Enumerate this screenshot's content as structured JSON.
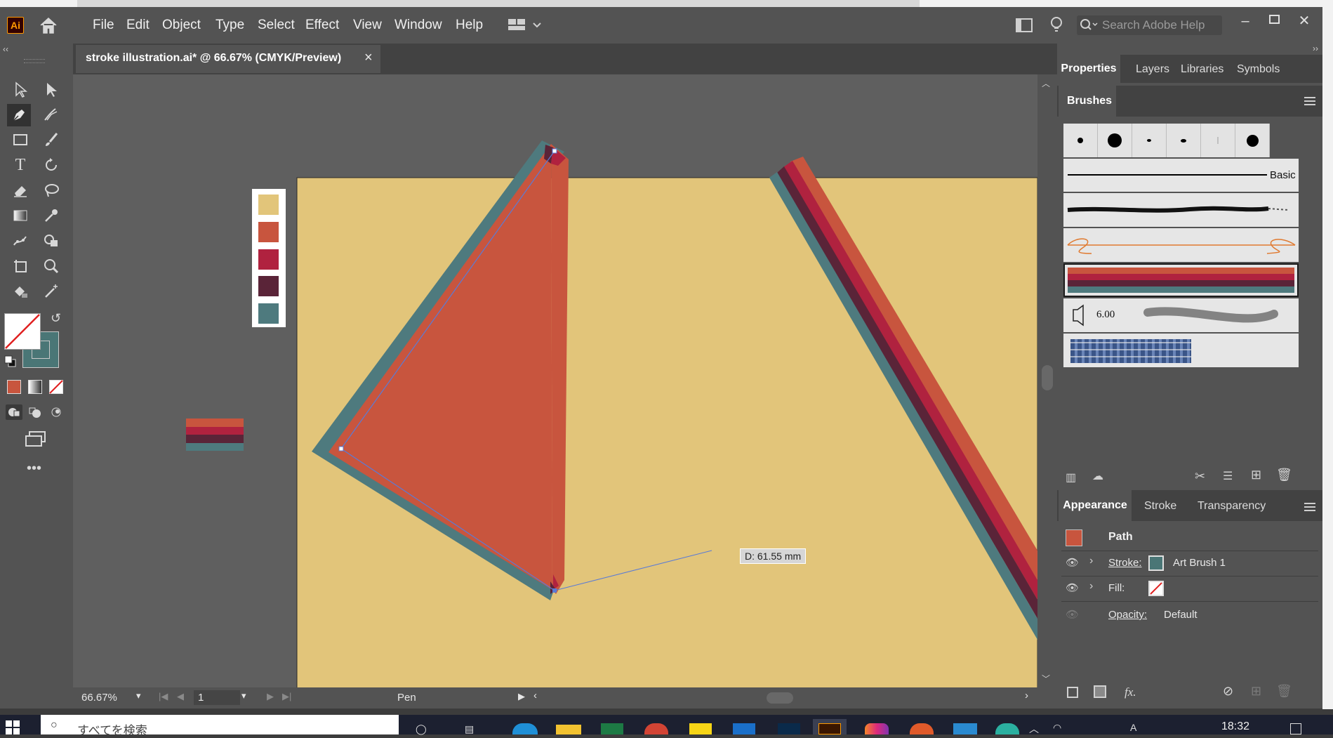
{
  "app": {
    "icon_label": "Ai"
  },
  "menu": [
    "File",
    "Edit",
    "Object",
    "Type",
    "Select",
    "Effect",
    "View",
    "Window",
    "Help"
  ],
  "search": {
    "placeholder": "Search Adobe Help"
  },
  "document": {
    "tab_title": "stroke illustration.ai* @ 66.67% (CMYK/Preview)",
    "close_glyph": "×"
  },
  "canvas": {
    "measure_label": "D: 61.55 mm",
    "palette": [
      "#e2c57a",
      "#c8553e",
      "#b0223f",
      "#5a2438",
      "#4e7a7e"
    ],
    "artboard_color": "#e2c57a"
  },
  "status": {
    "zoom": "66.67%",
    "artboard_num": "1",
    "tool_name": "Pen"
  },
  "right_panel": {
    "tabs": [
      "Properties",
      "Layers",
      "Libraries",
      "Symbols"
    ],
    "brushes_title": "Brushes",
    "basic_label": "Basic",
    "scatter_size": "6.00"
  },
  "appearance": {
    "tabs": [
      "Appearance",
      "Stroke",
      "Transparency"
    ],
    "object_type": "Path",
    "stroke_label": "Stroke:",
    "stroke_value": "Art Brush 1",
    "fill_label": "Fill:",
    "opacity_label": "Opacity:",
    "opacity_value": "Default",
    "fx_label": "fx."
  },
  "taskbar": {
    "search_placeholder": "すべてを検索",
    "time": "18:32"
  },
  "colors": {
    "accent_fill": "#c8553e",
    "selection_blue": "#5a7bd6"
  }
}
